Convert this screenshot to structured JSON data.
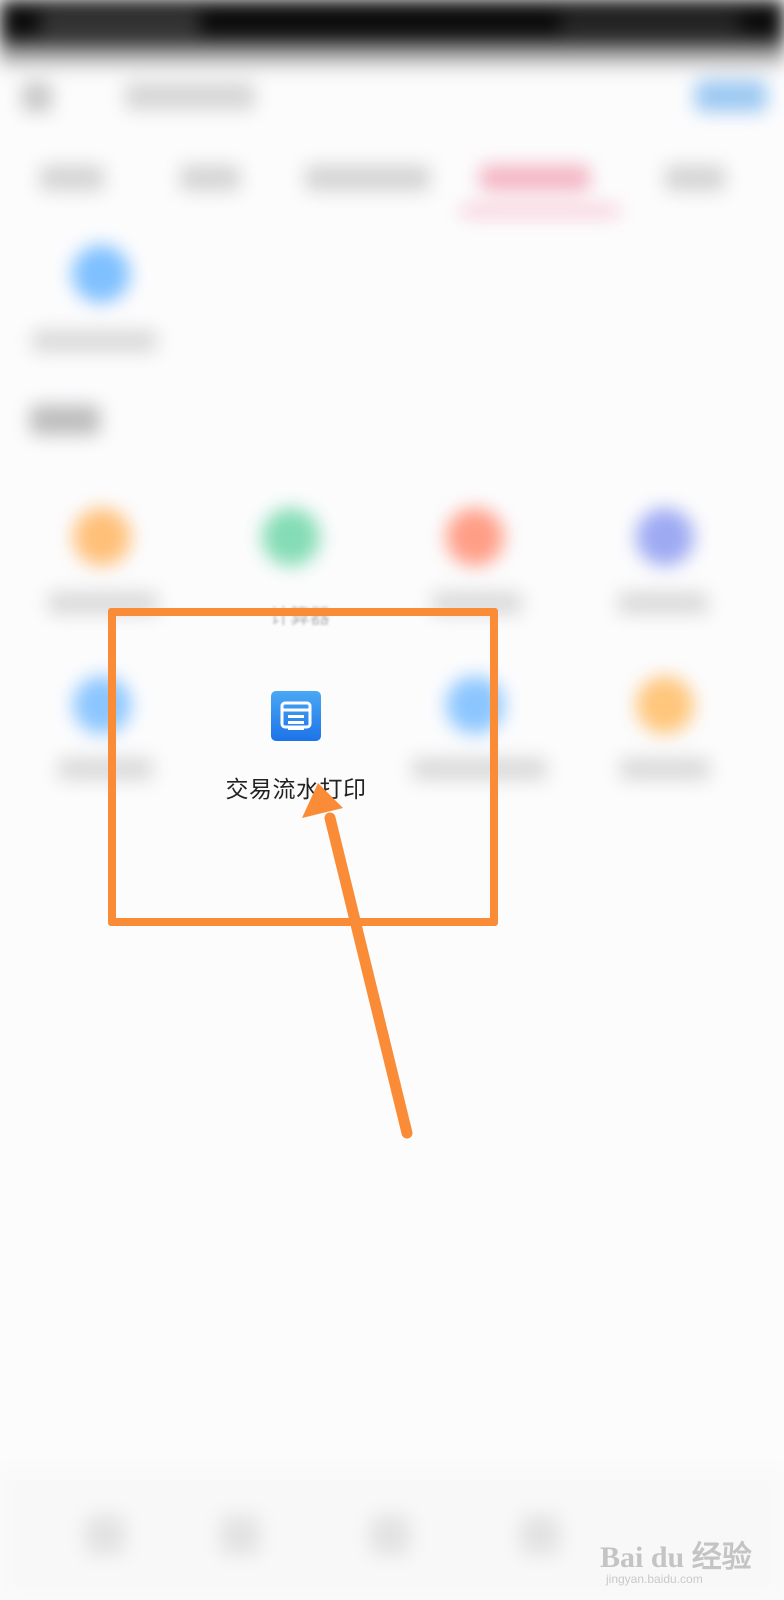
{
  "focused_item": {
    "label": "交易流水打印",
    "icon": "printer-icon",
    "icon_color": "#1d73e8"
  },
  "partial_label_above": "计算器",
  "annotation": {
    "color": "#fa8b37"
  },
  "watermark": {
    "main": "Bai du 经验",
    "sub": "jingyan.baidu.com"
  }
}
